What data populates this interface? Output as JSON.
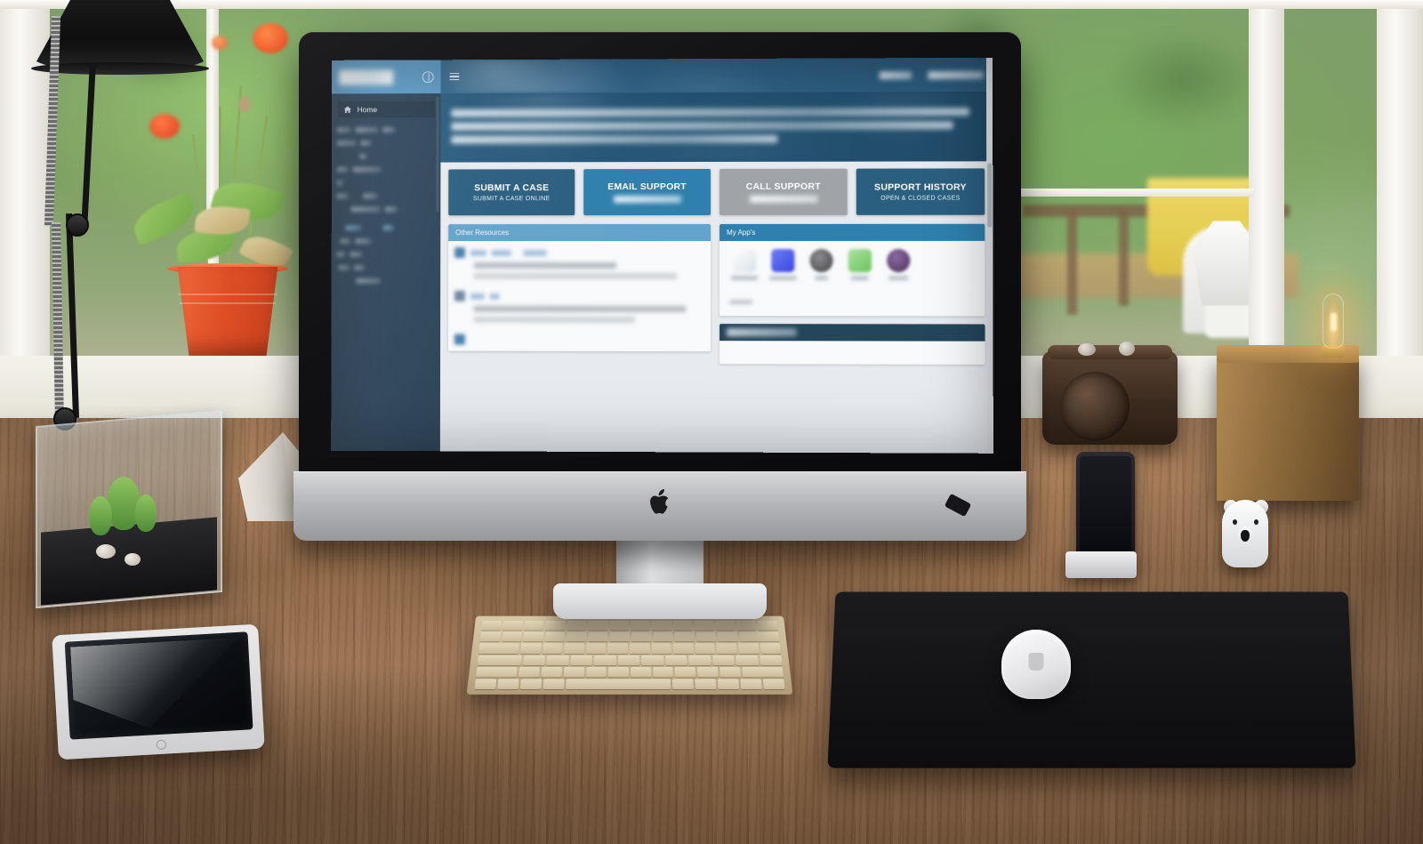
{
  "scene": {
    "description": "Support portal web app displayed on an iMac on a wooden desk by a window",
    "objects": [
      {
        "name": "desk-lamp"
      },
      {
        "name": "potted-plant"
      },
      {
        "name": "terrarium"
      },
      {
        "name": "origami-paper-object"
      },
      {
        "name": "tablet"
      },
      {
        "name": "keyboard"
      },
      {
        "name": "mousepad"
      },
      {
        "name": "mouse"
      },
      {
        "name": "smartphone-dock"
      },
      {
        "name": "vintage-camera"
      },
      {
        "name": "wood-block-lamp"
      },
      {
        "name": "polar-bear-figurine"
      }
    ]
  },
  "colors": {
    "brand_light_blue": "#5b9bc6",
    "brand_blue": "#2f80ae",
    "brand_dark_blue": "#2b5f80",
    "sidebar_navy": "#2d4459",
    "panel_header_light": "#64a3cb",
    "panel_header_dark": "#24465c",
    "tile_disabled_gray": "#9fa4a8",
    "content_bg": "#e7ebf0"
  },
  "app": {
    "sidebar": {
      "brand_logo": "company-logo",
      "toggle_icon": "collapse-toggle-icon",
      "nav": {
        "active_item": {
          "icon": "home-icon",
          "label": "Home"
        },
        "redacted_item_count": 14
      }
    },
    "topbar": {
      "menu_icon": "hamburger-menu-icon",
      "right_items": [
        "redacted-user-name",
        "redacted-menu-links"
      ]
    },
    "hero": {
      "line_count": 3,
      "note": "redacted banner headline text over photo background"
    },
    "tiles": [
      {
        "title": "SUBMIT A CASE",
        "subtitle": "SUBMIT A CASE ONLINE",
        "style": "dark",
        "subtitle_redacted": false
      },
      {
        "title": "EMAIL SUPPORT",
        "subtitle": "",
        "style": "blue",
        "subtitle_redacted": true
      },
      {
        "title": "CALL SUPPORT",
        "subtitle": "",
        "style": "gray",
        "subtitle_redacted": true
      },
      {
        "title": "SUPPORT HISTORY",
        "subtitle": "OPEN & CLOSED CASES",
        "style": "dark",
        "subtitle_redacted": false
      }
    ],
    "panels": {
      "other_resources": {
        "header": "Other Resources",
        "header_style": "light",
        "items_redacted": 3
      },
      "my_apps": {
        "header": "My App's",
        "header_style": "mid",
        "apps": [
          {
            "name": "app-1",
            "color": "#e8eef3"
          },
          {
            "name": "app-2",
            "color": "#4b5ff0"
          },
          {
            "name": "app-3",
            "color": "#5d5d5f"
          },
          {
            "name": "app-4",
            "color": "#84cf7a"
          },
          {
            "name": "app-5",
            "color": "#6d4a7c"
          }
        ]
      },
      "third_panel": {
        "header_redacted": true,
        "header_style": "dark"
      }
    },
    "scrollbars": {
      "sidebar": true,
      "page": true
    }
  }
}
